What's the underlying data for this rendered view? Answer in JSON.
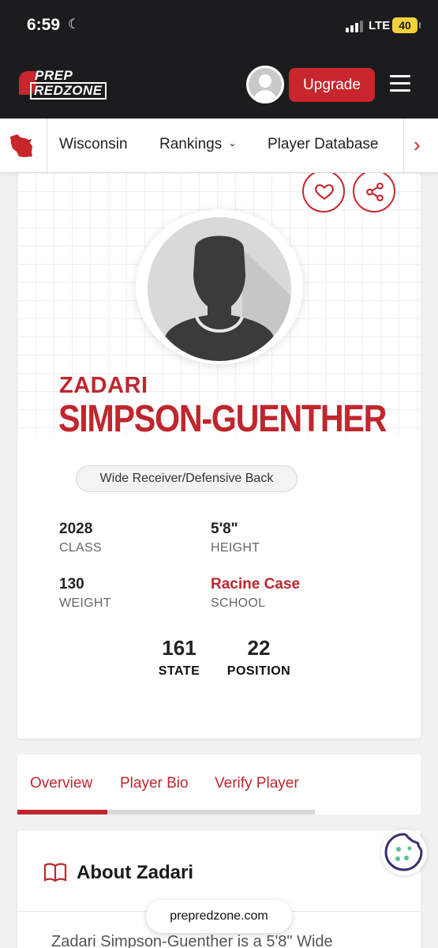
{
  "status_bar": {
    "time": "6:59",
    "network": "LTE",
    "battery": "40"
  },
  "header": {
    "logo_top": "PREP",
    "logo_bottom": "REDZONE",
    "upgrade_label": "Upgrade"
  },
  "nav": {
    "items": [
      {
        "label": "Wisconsin"
      },
      {
        "label": "Rankings"
      },
      {
        "label": "Player Database"
      }
    ]
  },
  "player": {
    "first_name": "ZADARI",
    "last_name": "SIMPSON-GUENTHER",
    "position": "Wide Receiver/Defensive Back",
    "stats": {
      "class_value": "2028",
      "class_label": "CLASS",
      "height_value": "5'8\"",
      "height_label": "HEIGHT",
      "weight_value": "130",
      "weight_label": "WEIGHT",
      "school_value": "Racine Case",
      "school_label": "SCHOOL"
    },
    "rankings": {
      "state_value": "161",
      "state_label": "STATE",
      "position_value": "22",
      "position_label": "POSITION"
    }
  },
  "tabs": [
    {
      "label": "Overview"
    },
    {
      "label": "Player Bio"
    },
    {
      "label": "Verify Player"
    }
  ],
  "about": {
    "title": "About Zadari",
    "text": "Zadari Simpson-Guenther is a 5'8\" Wide"
  },
  "browser": {
    "url": "prepredzone.com"
  },
  "colors": {
    "brand_red": "#c8262c",
    "dark_header": "#1c1c1e"
  },
  "icons": [
    "moon-icon",
    "signal-icon",
    "menu-icon",
    "wisconsin-state-icon",
    "chevron-right-icon",
    "heart-icon",
    "share-icon",
    "book-icon",
    "cookie-icon"
  ]
}
